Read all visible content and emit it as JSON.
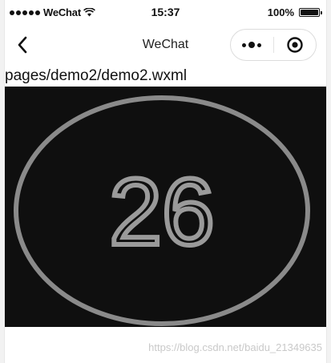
{
  "status_bar": {
    "carrier": "WeChat",
    "time": "15:37",
    "battery_text": "100%",
    "battery_level": 1.0,
    "signal_icon": "signal-dots-icon",
    "wifi_icon": "wifi-icon"
  },
  "nav": {
    "title": "WeChat",
    "back_icon": "back-chevron-icon",
    "more_icon": "more-dots-icon",
    "close_icon": "target-circle-icon"
  },
  "page": {
    "path": "pages/demo2/demo2.wxml"
  },
  "image": {
    "number_text": "26",
    "background_color": "#0f0f0f",
    "ring_color": "#8a8a8a"
  },
  "watermark": "https://blog.csdn.net/baidu_21349635"
}
